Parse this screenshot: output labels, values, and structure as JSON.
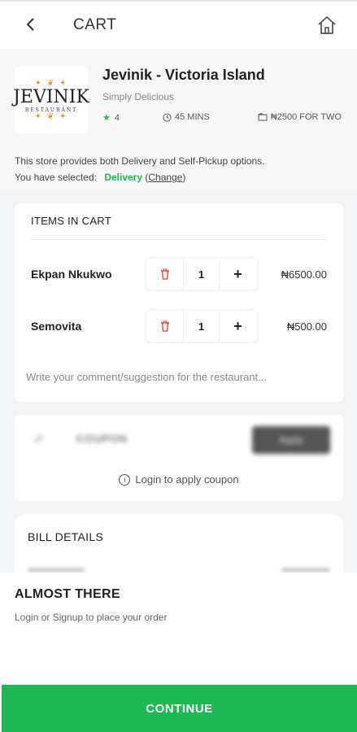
{
  "header": {
    "title": "CART",
    "back_icon": "chevron-left-icon",
    "home_icon": "home-icon"
  },
  "store": {
    "logo": {
      "name": "JEVINIK",
      "sub": "RESTAURANT"
    },
    "name": "Jevinik - Victoria Island",
    "tagline": "Simply Delicious",
    "rating": "4",
    "delivery_time": "45 MINS",
    "price_for_two": "₦2500 FOR TWO",
    "options_note": "This store provides both Delivery and Self-Pickup options.",
    "selected_prefix": "You have selected:",
    "selected_mode": "Delivery",
    "change_label": "Change",
    "accent_color": "#1db954"
  },
  "cart": {
    "heading": "ITEMS IN CART",
    "items": [
      {
        "name": "Ekpan Nkukwo",
        "qty": "1",
        "price": "₦6500.00"
      },
      {
        "name": "Semovita",
        "qty": "1",
        "price": "₦500.00"
      }
    ],
    "comment_placeholder": "Write your comment/suggestion for the restaurant..."
  },
  "coupon": {
    "label": "COUPON",
    "apply_label": "Apply",
    "login_note": "Login to apply coupon"
  },
  "bill": {
    "heading": "BILL DETAILS"
  },
  "sheet": {
    "title": "ALMOST THERE",
    "subtitle": "Login or Signup to place your order",
    "continue_label": "CONTINUE"
  }
}
